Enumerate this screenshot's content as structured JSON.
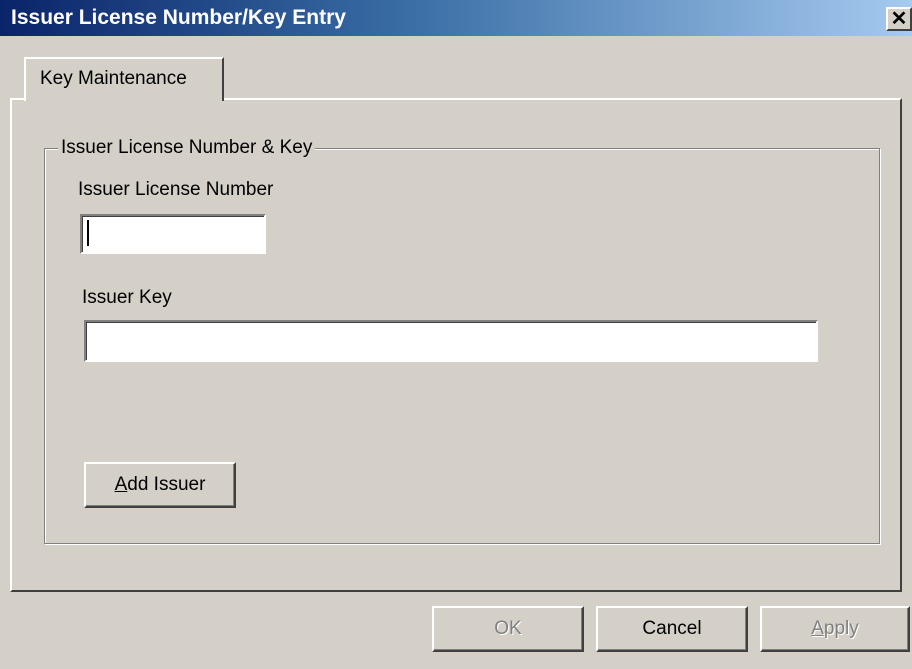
{
  "window": {
    "title": "Issuer License Number/Key Entry",
    "close_glyph": "✕"
  },
  "tabs": [
    {
      "label": "Key Maintenance",
      "selected": true
    }
  ],
  "group": {
    "title": "Issuer License Number & Key",
    "license_label": "Issuer License Number",
    "license_value": "",
    "key_label": "Issuer Key",
    "key_value": "",
    "add_button": {
      "mnemonic": "A",
      "rest": "dd Issuer"
    }
  },
  "footer": {
    "ok_label": "OK",
    "ok_enabled": false,
    "cancel_label": "Cancel",
    "cancel_enabled": true,
    "apply_mnemonic": "A",
    "apply_rest": "pply",
    "apply_enabled": false
  },
  "colors": {
    "titlebar_start": "#0a246a",
    "titlebar_end": "#a6caf0",
    "face": "#d4d0c8",
    "disabled_text": "#808080"
  },
  "icons": {
    "close": "close-icon"
  }
}
